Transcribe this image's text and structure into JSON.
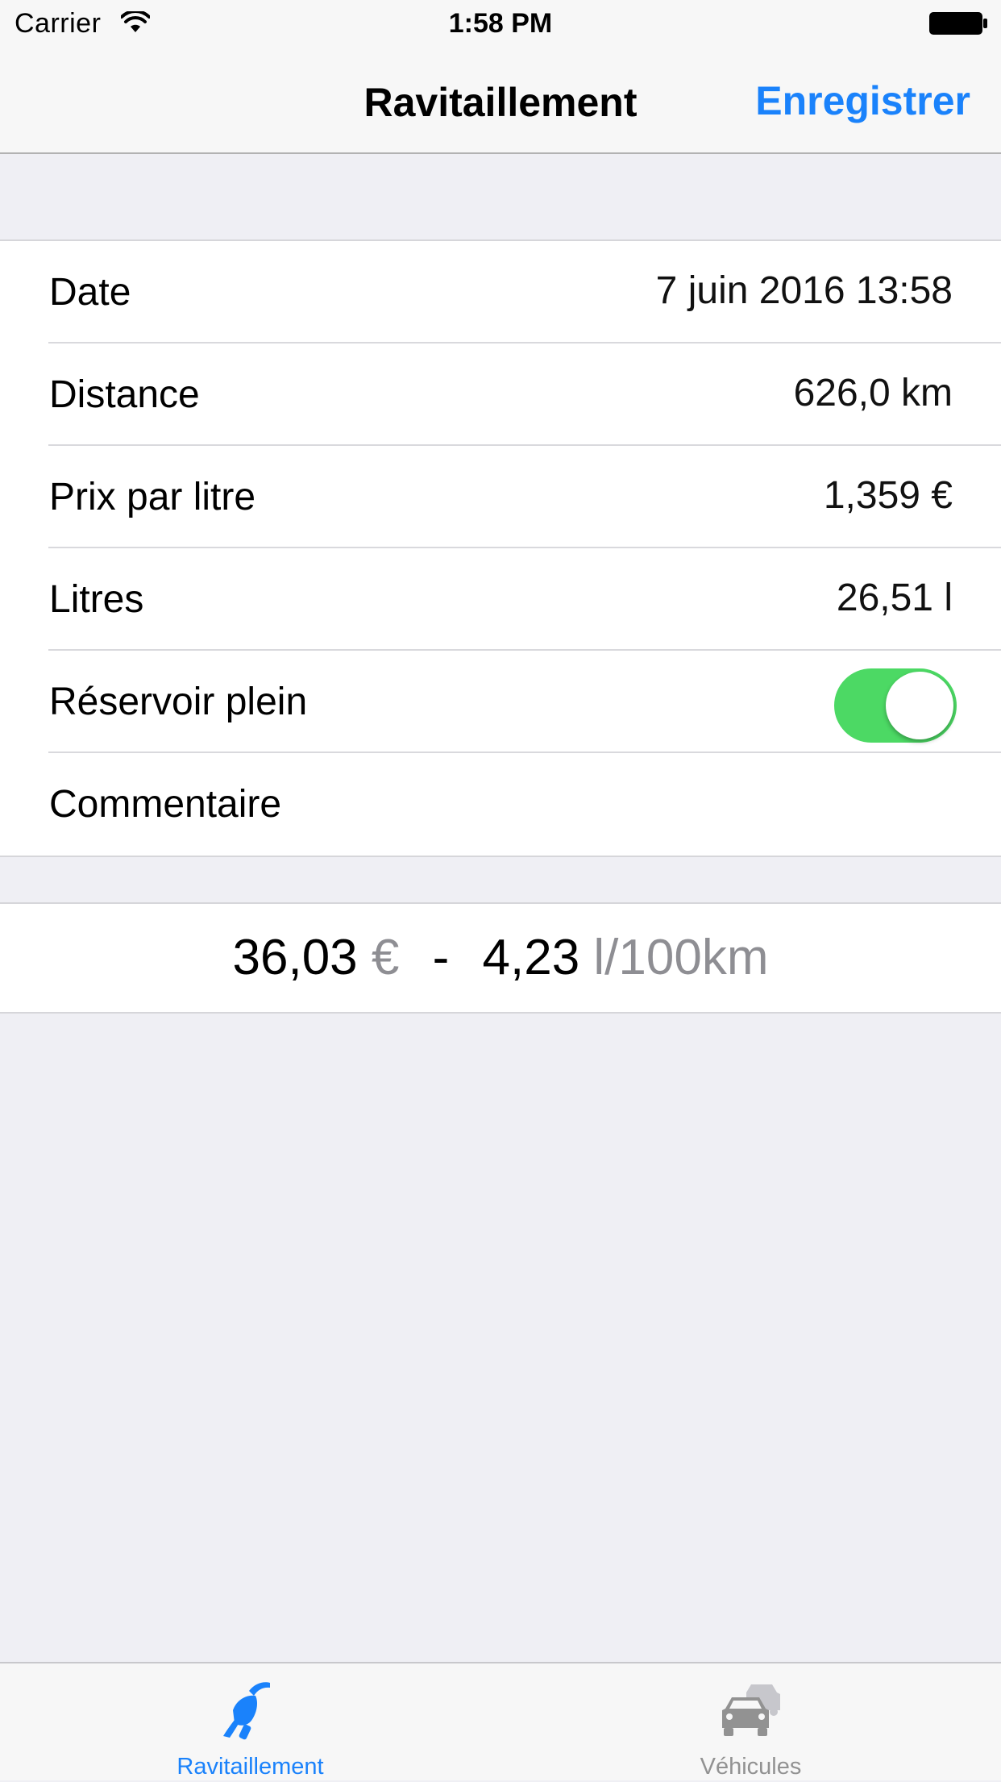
{
  "status_bar": {
    "carrier": "Carrier",
    "time": "1:58 PM"
  },
  "nav": {
    "title": "Ravitaillement",
    "save_label": "Enregistrer",
    "accent_color": "#1a82fb"
  },
  "form": {
    "rows": [
      {
        "label": "Date",
        "value": "7 juin 2016 13:58"
      },
      {
        "label": "Distance",
        "value": "626,0 km"
      },
      {
        "label": "Prix par litre",
        "value": "1,359 €"
      },
      {
        "label": "Litres",
        "value": "26,51 l"
      },
      {
        "label": "Réservoir plein",
        "toggle_on": true,
        "toggle_color": "#4cd964"
      },
      {
        "label": "Commentaire",
        "value": ""
      }
    ]
  },
  "summary": {
    "cost": "36,03",
    "cost_unit": "€",
    "separator": "-",
    "consumption": "4,23",
    "consumption_unit": "l/100km"
  },
  "tabs": [
    {
      "label": "Ravitaillement",
      "icon": "fuel-nozzle-icon",
      "active": true,
      "color": "#1a82fb"
    },
    {
      "label": "Véhicules",
      "icon": "cars-icon",
      "active": false,
      "color": "#929292"
    }
  ]
}
